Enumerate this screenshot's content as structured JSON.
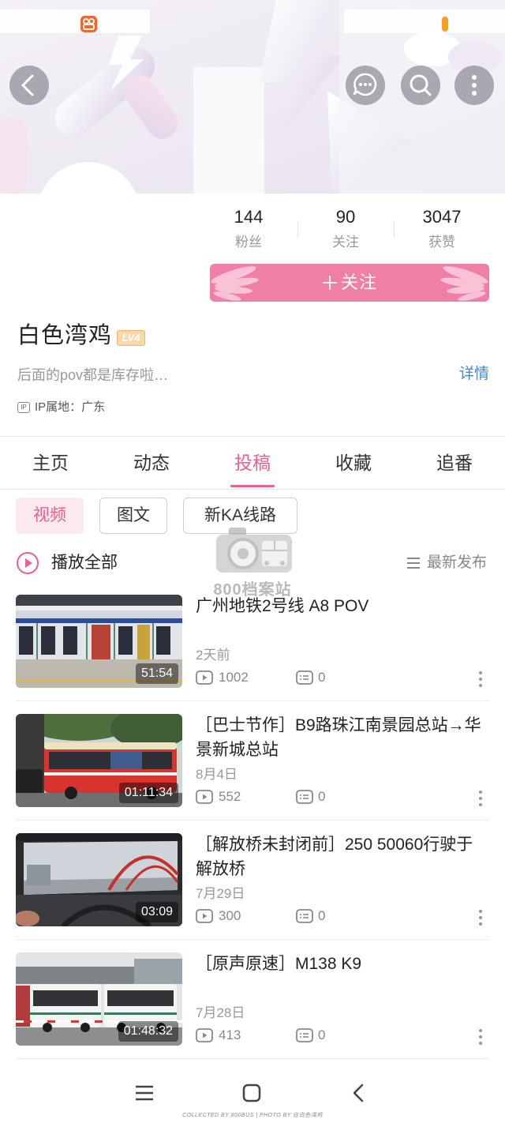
{
  "status_bar": {
    "app_icon": "app-status-icon",
    "battery_icon": "battery-icon"
  },
  "header": {
    "back_icon": "back-chevron-icon",
    "actions": [
      "chat-bubble-icon",
      "search-icon",
      "more-vertical-icon"
    ]
  },
  "profile": {
    "avatar": "avatar-placeholder",
    "stats": [
      {
        "value": "144",
        "label": "粉丝"
      },
      {
        "value": "90",
        "label": "关注"
      },
      {
        "value": "3047",
        "label": "获赞"
      }
    ],
    "follow": {
      "icon": "plus-icon",
      "label": "关注"
    },
    "name": "白色湾鸡",
    "level": "LV4",
    "bio": "后面的pov都是库存啦…",
    "detail_link": "详情",
    "ip_icon_text": "IP",
    "ip_location": "IP属地：广东"
  },
  "tabs": [
    {
      "label": "主页",
      "active": false
    },
    {
      "label": "动态",
      "active": false
    },
    {
      "label": "投稿",
      "active": true
    },
    {
      "label": "收藏",
      "active": false
    },
    {
      "label": "追番",
      "active": false
    }
  ],
  "filters": [
    {
      "label": "视频",
      "selected": true
    },
    {
      "label": "图文",
      "selected": false
    },
    {
      "label": "新KA线路",
      "selected": false
    }
  ],
  "list_header": {
    "play_all": "播放全部",
    "sort": "最新发布"
  },
  "videos": [
    {
      "title": "广州地铁2号线 A8 POV",
      "duration": "51:54",
      "date": "2天前",
      "views": "1002",
      "comments": "0"
    },
    {
      "title": "［巴士节作］B9路珠江南景园总站→华景新城总站",
      "duration": "01:11:34",
      "date": "8月4日",
      "views": "552",
      "comments": "0"
    },
    {
      "title": "［解放桥未封闭前］250 50060行驶于解放桥",
      "duration": "03:09",
      "date": "7月29日",
      "views": "300",
      "comments": "0"
    },
    {
      "title": "［原声原速］M138 K9",
      "duration": "01:48:32",
      "date": "7月28日",
      "views": "413",
      "comments": "0"
    }
  ],
  "watermark": {
    "text": "800档案站",
    "credit": "COLLECTED BY 800BUS | PHOTO BY @白色湾鸡"
  },
  "system_nav": [
    "menu-icon",
    "home-square-icon",
    "back-icon"
  ],
  "colors": {
    "accent_pink": "#e9628f",
    "follow_button": "#f07fa6",
    "link_blue": "#3f8bd8",
    "level_badge": "#f6b26b"
  }
}
